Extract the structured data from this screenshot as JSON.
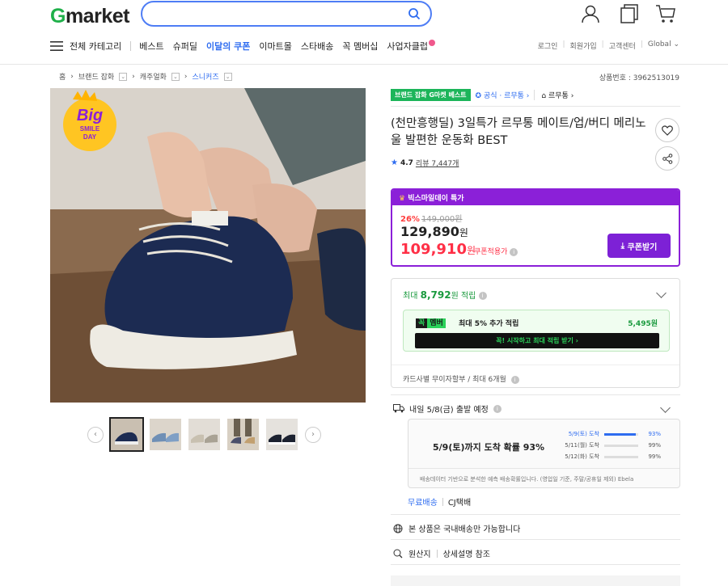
{
  "header": {
    "logo_g": "G",
    "logo_rest": "market",
    "search_placeholder": "",
    "nav": {
      "all_categories": "전체 카테고리",
      "items": [
        "베스트",
        "슈퍼딜",
        "이달의 쿠폰",
        "이마트몰",
        "스타배송",
        "꼭 멤버십",
        "사업자클럽"
      ]
    },
    "util": [
      "로그인",
      "회원가입",
      "고객센터",
      "Global"
    ]
  },
  "breadcrumb": {
    "items": [
      "홈",
      "브랜드 잡화",
      "캐주얼화",
      "스니커즈"
    ],
    "product_number": "상품번호 : 3962513019"
  },
  "badges": {
    "best": "브랜드 잡화 G마켓 베스트",
    "official": "공식 · 르무통",
    "brand": "르무통"
  },
  "product": {
    "title": "(천만흥행딜) 3일특가 르무통 메이트/업/버디 메리노울 발편한 운동화 BEST",
    "rating": "4.7",
    "reviews": "리뷰 7,447개",
    "image_badge": {
      "big": "Big",
      "smile": "SMILE",
      "day": "DAY"
    }
  },
  "price": {
    "event": "빅스마일데이 특가",
    "discount": "26%",
    "original": "149,000원",
    "sale_num": "129,890",
    "sale_unit": "원",
    "coupon_num": "109,910",
    "coupon_unit": "원",
    "coupon_label": "쿠폰적용가",
    "coupon_button": "쿠폰받기"
  },
  "points": {
    "max_prefix": "최대",
    "max_amount": "8,792",
    "max_suffix": "원 적립",
    "smile_k": "꼭",
    "smile_m": "멤버",
    "smile_text": "최대 5% 추가 적립",
    "smile_amount": "5,495원",
    "smile_bar": "꼭! 시작하고 최대 적립 받기  ›",
    "card": "카드사별 무이자할부 / 최대 6개월"
  },
  "shipping": {
    "departure": "내일 5/8(금) 출발 예정",
    "prob_title": "5/9(토)까지 도착 확률 93%",
    "rows": [
      {
        "label": "5/9(토) 도착",
        "value": "93%",
        "pct": 93
      },
      {
        "label": "5/11(월) 도착",
        "value": "99%",
        "pct": 99
      },
      {
        "label": "5/12(화) 도착",
        "value": "99%",
        "pct": 99
      }
    ],
    "note": "배송데이터 기반으로 분석한 예측 배송확률입니다. (영업일 기준, 주말/공휴일 제외)",
    "note_brand": "Ebela",
    "free": "무료배송",
    "courier": "CJ택배"
  },
  "info_rows": {
    "domestic": "본 상품은 국내배송만 가능합니다",
    "origin": "원산지",
    "origin_detail": "상세설명 참조"
  },
  "colors": {
    "accent": "#2e6cf0",
    "purple": "#8b20d8",
    "red": "#ff2f46",
    "green": "#1fb04a"
  }
}
